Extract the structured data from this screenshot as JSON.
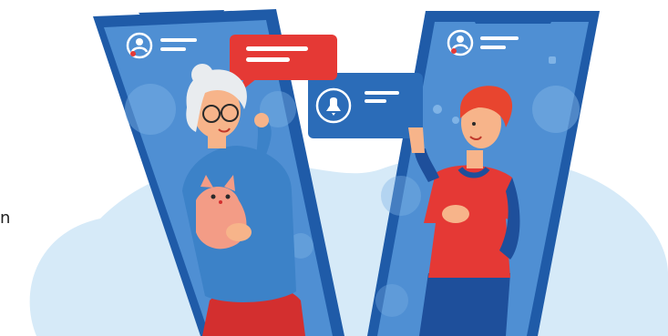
{
  "illustration": {
    "stray_text": "n",
    "palette": {
      "background": "#ffffff",
      "blob": "#d6eaf8",
      "phone_frame": "#1f5ba8",
      "phone_screen": "#4f8fd3",
      "screen_light": "#7fb3e6",
      "bubble_red": "#e53935",
      "notification_card": "#2b6cb8",
      "grandma_sweater": "#3c82c8",
      "grandma_skirt": "#d32f2f",
      "hair_grey": "#e9ecef",
      "skin": "#f7b48a",
      "cat": "#f39c86",
      "boy_shirt": "#e53935",
      "boy_hair": "#e8452f",
      "boy_pants": "#1e4f9b"
    },
    "icons": [
      "avatar-icon",
      "bell-icon"
    ]
  }
}
